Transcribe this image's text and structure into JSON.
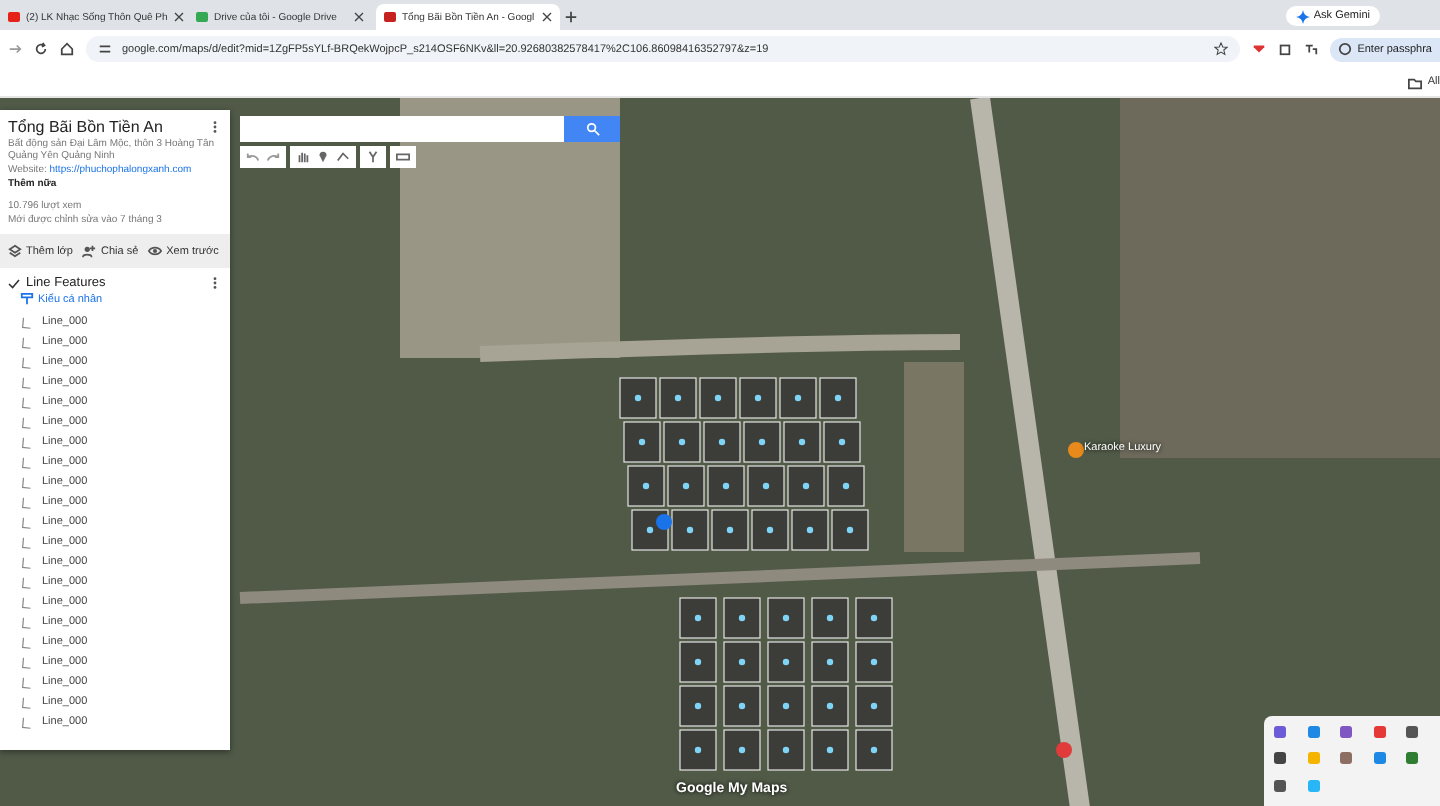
{
  "tabs": [
    {
      "title": "(2) LK Nhạc Sống Thôn Quê Ph",
      "selected": false,
      "kind": "video"
    },
    {
      "title": "Drive của tôi - Google Drive",
      "selected": false,
      "kind": "drive"
    },
    {
      "title": "Tổng Bãi Bồn Tiền An - Googl",
      "selected": true,
      "kind": "maps"
    }
  ],
  "address_bar": {
    "url": "google.com/maps/d/edit?mid=1ZgFP5sYLf-BRQekWojpcP_s214OSF6NKv&ll=20.92680382578417%2C106.86098416352797&z=19"
  },
  "gemini_button": "Ask Gemini",
  "passphrase_button": "Enter passphra",
  "bookmarks_bar": {
    "all_bookmarks": "All"
  },
  "map": {
    "place_label": "Karaoke Luxury",
    "logo": "Google My Maps"
  },
  "panel": {
    "title": "Tổng Bãi Bồn Tiền An",
    "description": "Bất động sản Đại Lâm Mộc, thôn 3 Hoàng Tân Quảng Yên Quảng Ninh",
    "website_label": "Website:",
    "website_link": "https://phuchophalongxanh.com",
    "more": "Thêm nữa",
    "views": "10.796 lượt xem",
    "edited": "Mới được chỉnh sửa vào 7 tháng 3",
    "actions": [
      {
        "label": "Thêm lớp",
        "kind": "layer"
      },
      {
        "label": "Chia sẻ",
        "kind": "share"
      },
      {
        "label": "Xem trước",
        "kind": "preview"
      }
    ],
    "layer": {
      "name": "Line Features",
      "checked": true,
      "style": "Kiểu cá nhân",
      "items": [
        "Line_000",
        "Line_000",
        "Line_000",
        "Line_000",
        "Line_000",
        "Line_000",
        "Line_000",
        "Line_000",
        "Line_000",
        "Line_000",
        "Line_000",
        "Line_000",
        "Line_000",
        "Line_000",
        "Line_000",
        "Line_000",
        "Line_000",
        "Line_000",
        "Line_000",
        "Line_000",
        "Line_000"
      ]
    }
  }
}
